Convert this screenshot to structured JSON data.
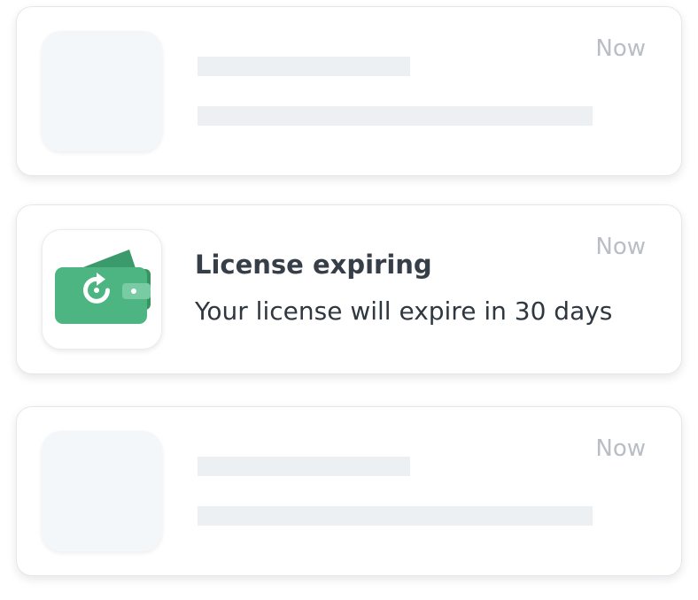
{
  "notifications": [
    {
      "state": "placeholder",
      "time": "Now"
    },
    {
      "state": "loaded",
      "time": "Now",
      "icon": "wallet-renew-icon",
      "title": "License expiring",
      "message": "Your license will expire in 30 days"
    },
    {
      "state": "placeholder",
      "time": "Now"
    }
  ],
  "colors": {
    "wallet_green": "#4cb582",
    "wallet_dark_green": "#3a9a6c",
    "placeholder_bg": "#f4f7fa",
    "skeleton_bar": "#edf0f3",
    "time_text": "#b9bec4",
    "title_text": "#363e47"
  }
}
